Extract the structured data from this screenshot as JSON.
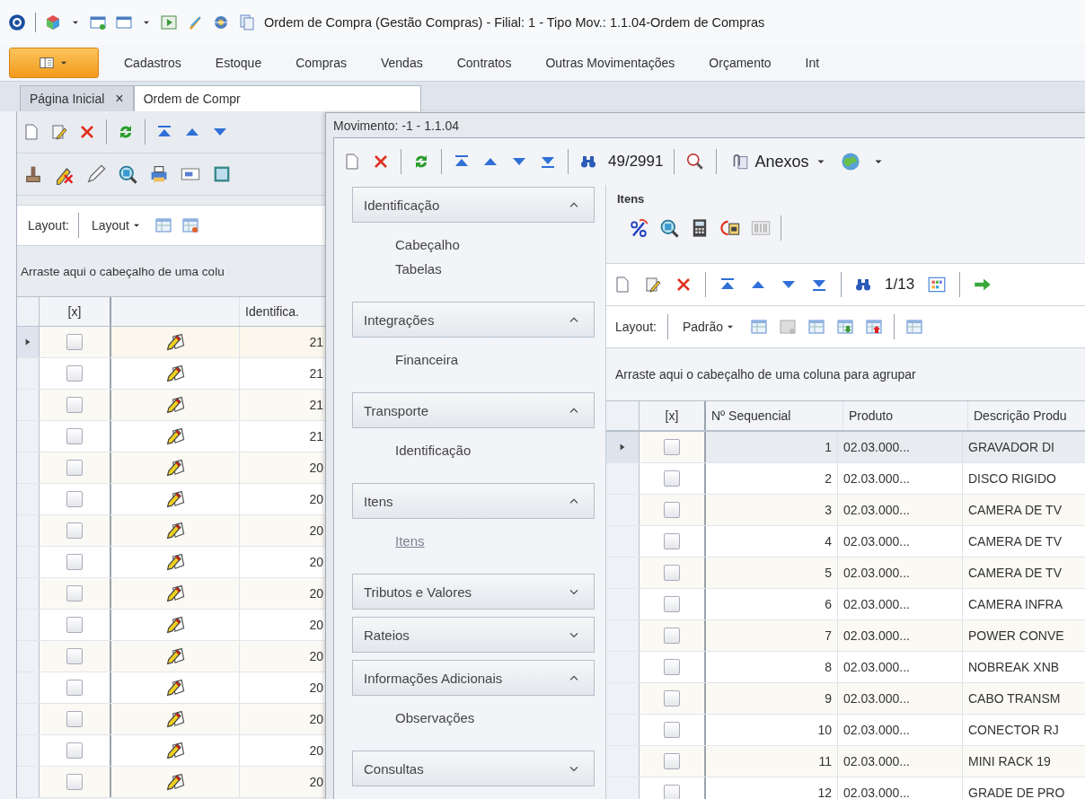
{
  "title_bar": {
    "title": "Ordem de Compra (Gestão Compras) - Filial: 1 - Tipo Mov.: 1.1.04-Ordem de Compras"
  },
  "menu": [
    "Cadastros",
    "Estoque",
    "Compras",
    "Vendas",
    "Contratos",
    "Outras Movimentações",
    "Orçamento",
    "Int"
  ],
  "tabs": [
    {
      "label": "Página Inicial",
      "close": "×",
      "selected": false
    },
    {
      "label": "Ordem de Compr",
      "selected": true
    }
  ],
  "list_view": {
    "layout_label": "Layout:",
    "layout_button": "Layout",
    "group_hint": "Arraste aqui o cabeçalho de uma colu",
    "columns": [
      "[x]",
      "Identifica."
    ],
    "rows": [
      {
        "value": "21",
        "checked": false,
        "selected": true
      },
      {
        "value": "21",
        "checked": false,
        "selected": false
      },
      {
        "value": "21",
        "checked": false,
        "selected": false
      },
      {
        "value": "21",
        "checked": false,
        "selected": false
      },
      {
        "value": "20",
        "checked": false,
        "selected": false
      },
      {
        "value": "20",
        "checked": false,
        "selected": false
      },
      {
        "value": "20",
        "checked": false,
        "selected": false
      },
      {
        "value": "20",
        "checked": false,
        "selected": false
      },
      {
        "value": "20",
        "checked": false,
        "selected": false
      },
      {
        "value": "20",
        "checked": false,
        "selected": false
      },
      {
        "value": "20",
        "checked": false,
        "selected": false
      },
      {
        "value": "20",
        "checked": false,
        "selected": false
      },
      {
        "value": "20",
        "checked": false,
        "selected": false
      },
      {
        "value": "20",
        "checked": false,
        "selected": false
      },
      {
        "value": "20",
        "checked": false,
        "selected": false
      }
    ]
  },
  "dialog": {
    "title": "Movimento: -1 - 1.1.04",
    "record_counter": "49/2991",
    "attachments": "Anexos",
    "nav": [
      {
        "title": "Identificação",
        "expanded": true,
        "items": [
          {
            "label": "Cabeçalho",
            "selected": false
          },
          {
            "label": "Tabelas",
            "selected": false
          }
        ]
      },
      {
        "title": "Integrações",
        "expanded": true,
        "items": [
          {
            "label": "Financeira",
            "selected": false
          }
        ]
      },
      {
        "title": "Transporte",
        "expanded": true,
        "items": [
          {
            "label": "Identificação",
            "selected": false
          }
        ]
      },
      {
        "title": "Itens",
        "expanded": true,
        "items": [
          {
            "label": "Itens",
            "selected": true
          }
        ]
      },
      {
        "title": "Tributos e Valores",
        "expanded": false
      },
      {
        "title": "Rateios",
        "expanded": false
      },
      {
        "title": "Informações Adicionais",
        "expanded": true,
        "items": [
          {
            "label": "Observações",
            "selected": false
          }
        ]
      },
      {
        "title": "Consultas",
        "expanded": false
      }
    ],
    "items_panel": {
      "title": "Itens",
      "record_counter": "1/13",
      "layout_label": "Layout:",
      "layout_button": "Padrão",
      "group_hint": "Arraste aqui o cabeçalho de uma coluna para agrupar",
      "columns": [
        "[x]",
        "Nº Sequencial",
        "Produto",
        "Descrição Produ"
      ],
      "rows": [
        {
          "seq": "1",
          "product": "02.03.000...",
          "description": "GRAVADOR DI",
          "checked": false,
          "selected": true
        },
        {
          "seq": "2",
          "product": "02.03.000...",
          "description": "DISCO RIGIDO",
          "checked": false,
          "selected": false
        },
        {
          "seq": "3",
          "product": "02.03.000...",
          "description": "CAMERA DE TV",
          "checked": false,
          "selected": false
        },
        {
          "seq": "4",
          "product": "02.03.000...",
          "description": "CAMERA DE TV",
          "checked": false,
          "selected": false
        },
        {
          "seq": "5",
          "product": "02.03.000...",
          "description": "CAMERA DE TV",
          "checked": false,
          "selected": false
        },
        {
          "seq": "6",
          "product": "02.03.000...",
          "description": "CAMERA INFRA",
          "checked": false,
          "selected": false
        },
        {
          "seq": "7",
          "product": "02.03.000...",
          "description": "POWER CONVE",
          "checked": false,
          "selected": false
        },
        {
          "seq": "8",
          "product": "02.03.000...",
          "description": "NOBREAK XNB",
          "checked": false,
          "selected": false
        },
        {
          "seq": "9",
          "product": "02.03.000...",
          "description": "CABO TRANSM",
          "checked": false,
          "selected": false
        },
        {
          "seq": "10",
          "product": "02.03.000...",
          "description": "CONECTOR RJ",
          "checked": false,
          "selected": false
        },
        {
          "seq": "11",
          "product": "02.03.000...",
          "description": "MINI RACK 19",
          "checked": false,
          "selected": false
        },
        {
          "seq": "12",
          "product": "02.03.000...",
          "description": "GRADE DE PRO",
          "checked": false,
          "selected": false
        }
      ]
    }
  }
}
